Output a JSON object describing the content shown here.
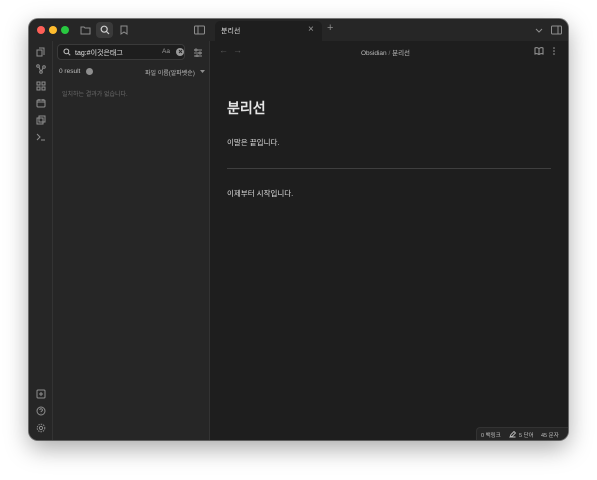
{
  "titlebar": {
    "traffic_colors": [
      "#fe5f57",
      "#febc2e",
      "#28c840"
    ],
    "left_icons": [
      "folder-icon",
      "search-icon",
      "bookmark-icon"
    ],
    "sidebar_toggle_icon": "sidebar-toggle-icon"
  },
  "tabs": [
    {
      "label": "분리선",
      "close": "×",
      "active": true
    }
  ],
  "new_tab": "+",
  "tab_menu_icon": "chevron-down-icon",
  "right_sidebar_icon": "right-sidebar-icon",
  "ribbon": {
    "top_icons": [
      "open-switcher-icon",
      "graph-view-icon",
      "canvas-icon",
      "daily-note-icon",
      "templates-icon",
      "command-palette-icon"
    ],
    "bottom_icons": [
      "vault-switcher-icon",
      "help-icon",
      "settings-icon"
    ]
  },
  "search": {
    "query": "tag:#이것은태그",
    "match_case": "Aa",
    "clear_icon": "clear-icon",
    "filter_icon": "search-settings-icon",
    "result_count": "0 result",
    "sort_label": "파일 이름(알파벳순)",
    "empty_message": "일치하는 결과가 없습니다."
  },
  "nav": {
    "back": "←",
    "forward": "→",
    "breadcrumb_vault": "Obsidian",
    "breadcrumb_sep": "/",
    "breadcrumb_file": "분리선",
    "reading_icon": "book-icon",
    "more_icon": "more-options-icon"
  },
  "note": {
    "title": "분리선",
    "line1": "이말은 끝입니다.",
    "line2": "이제부터 시작입니다."
  },
  "status": {
    "backlinks": "0 백링크",
    "edit_icon": "pencil-icon",
    "words": "5 단어",
    "chars": "45 문자"
  }
}
